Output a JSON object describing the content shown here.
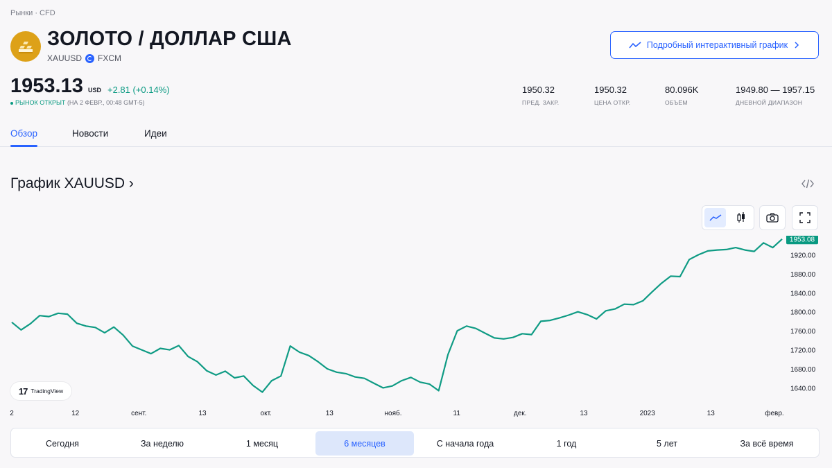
{
  "breadcrumb": "Рынки · CFD",
  "symbol": {
    "title": "ЗОЛОТО / ДОЛЛАР США",
    "ticker": "XAUUSD",
    "source": "FXCM",
    "logo_color": "#dda118"
  },
  "header_button": {
    "label": "Подробный интерактивный график"
  },
  "quote": {
    "price": "1953.13",
    "currency": "USD",
    "change": "+2.81 (+0.14%)",
    "status_open": "РЫНОК ОТКРЫТ",
    "status_time": "(НА 2 ФЕВР., 00:48 GMT-5)"
  },
  "stats": [
    {
      "value": "1950.32",
      "label": "ПРЕД. ЗАКР."
    },
    {
      "value": "1950.32",
      "label": "ЦЕНА ОТКР."
    },
    {
      "value": "80.096K",
      "label": "ОБЪЁМ"
    },
    {
      "value": "1949.80 — 1957.15",
      "label": "ДНЕВНОЙ ДИАПАЗОН"
    }
  ],
  "tabs": [
    {
      "label": "Обзор",
      "active": true
    },
    {
      "label": "Новости",
      "active": false
    },
    {
      "label": "Идеи",
      "active": false
    }
  ],
  "section_title": "График XAUUSD ›",
  "tv_badge": {
    "logo": "17",
    "text": "TradingView"
  },
  "colors": {
    "accent": "#2962ff",
    "up": "#089981",
    "line": "#0f9b84"
  },
  "chart_data": {
    "type": "line",
    "series": [
      {
        "x_ticks": [
          "2",
          "12",
          "сент.",
          "13",
          "окт.",
          "13",
          "нояб.",
          "11",
          "дек.",
          "13",
          "2023",
          "13",
          "февр."
        ],
        "values": [
          1778,
          1762,
          1775,
          1792,
          1790,
          1797,
          1795,
          1776,
          1770,
          1767,
          1756,
          1768,
          1751,
          1728,
          1720,
          1712,
          1723,
          1720,
          1729,
          1706,
          1695,
          1676,
          1667,
          1675,
          1661,
          1665,
          1645,
          1631,
          1655,
          1665,
          1728,
          1715,
          1708,
          1695,
          1680,
          1673,
          1670,
          1663,
          1660,
          1650,
          1640,
          1644,
          1655,
          1662,
          1652,
          1648,
          1634,
          1710,
          1760,
          1770,
          1765,
          1755,
          1745,
          1743,
          1746,
          1754,
          1752,
          1780,
          1782,
          1787,
          1793,
          1800,
          1794,
          1785,
          1802,
          1806,
          1816,
          1815,
          1823,
          1842,
          1860,
          1875,
          1874,
          1910,
          1920,
          1928,
          1930,
          1931,
          1935,
          1930,
          1927,
          1945,
          1935,
          1953
        ]
      }
    ],
    "y_ticks": [
      1920,
      1880,
      1840,
      1800,
      1760,
      1720,
      1680,
      1640
    ],
    "ylim": [
      1610,
      1960
    ],
    "last_value_label": "1953.08",
    "grid": false
  },
  "ranges": [
    {
      "label": "Сегодня",
      "active": false
    },
    {
      "label": "За неделю",
      "active": false
    },
    {
      "label": "1 месяц",
      "active": false
    },
    {
      "label": "6 месяцев",
      "active": true
    },
    {
      "label": "С начала года",
      "active": false
    },
    {
      "label": "1 год",
      "active": false
    },
    {
      "label": "5 лет",
      "active": false
    },
    {
      "label": "За всё время",
      "active": false
    }
  ]
}
